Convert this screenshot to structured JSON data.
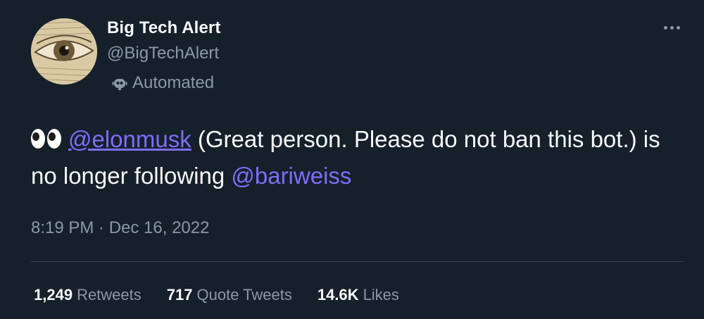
{
  "author": {
    "display_name": "Big Tech Alert",
    "handle": "@BigTechAlert",
    "label": "Automated",
    "avatar_icon": "eye-engraving-avatar",
    "label_icon": "robot-icon"
  },
  "tweet": {
    "emoji": "eyes-emoji",
    "mention_1": "@elonmusk",
    "text_1": " (Great person. Please do not ban this bot.) is no longer following ",
    "mention_2": "@bariweiss",
    "timestamp": "8:19 PM · Dec 16, 2022"
  },
  "stats": {
    "retweets_count": "1,249",
    "retweets_label": "Retweets",
    "quotes_count": "717",
    "quotes_label": "Quote Tweets",
    "likes_count": "14.6K",
    "likes_label": "Likes"
  },
  "colors": {
    "background": "#15202b",
    "mention": "#7f6dfa",
    "secondary_text": "#8b98a5"
  }
}
